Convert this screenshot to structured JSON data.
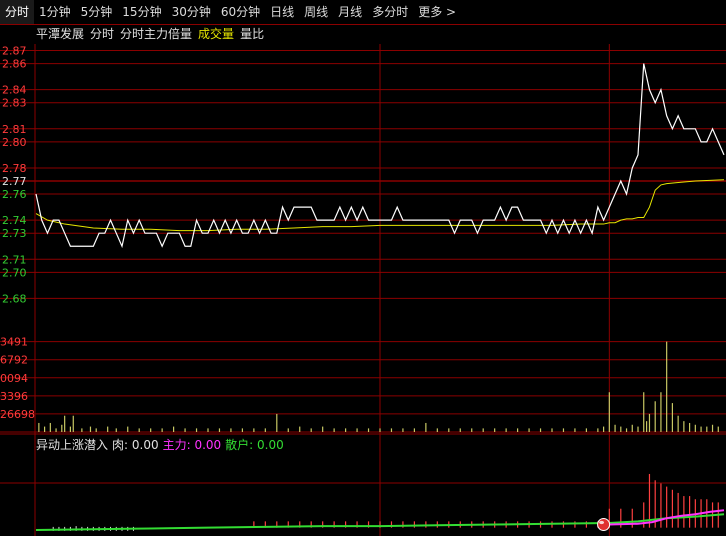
{
  "tabs": [
    "分时",
    "1分钟",
    "5分钟",
    "15分钟",
    "30分钟",
    "60分钟",
    "日线",
    "周线",
    "月线",
    "多分时",
    "更多 >"
  ],
  "active_tab": 0,
  "legend_top": [
    {
      "label": "平潭发展",
      "color": "#e0e0e0"
    },
    {
      "label": "分时",
      "color": "#e0e0e0"
    },
    {
      "label": "分时主力倍量",
      "color": "#e0e0e0"
    },
    {
      "label": "成交量",
      "color": "#e6e600"
    },
    {
      "label": "量比",
      "color": "#e0e0e0"
    }
  ],
  "legend_bottom": [
    {
      "label": "异动上涨潜入",
      "color": "#e0e0e0"
    },
    {
      "label": "肉: 0.00",
      "color": "#e0e0e0"
    },
    {
      "label": "主力: 0.00",
      "color": "#ff33ff"
    },
    {
      "label": "散户: 0.00",
      "color": "#33dd33"
    }
  ],
  "colors": {
    "grid": "#8b0000",
    "up": "#ff3b3b",
    "down": "#33cc33",
    "price": "#ffffff",
    "avg": "#e6e600",
    "vol": "#c8c864",
    "main": "#ff33ff",
    "retail": "#33dd33",
    "bar_red": "#ff4040",
    "bar_white": "#dddddd"
  },
  "chart_data": [
    {
      "type": "line",
      "name": "price",
      "y_ticks": [
        2.87,
        2.86,
        2.84,
        2.83,
        2.81,
        2.8,
        2.78,
        2.77,
        2.76,
        2.74,
        2.73,
        2.71,
        2.7,
        2.68
      ],
      "y_ticks_up": [
        2.87,
        2.86,
        2.84,
        2.83,
        2.81,
        2.8,
        2.78
      ],
      "y_ticks_down": [
        2.76,
        2.74,
        2.73,
        2.71,
        2.7,
        2.68
      ],
      "y_ticks_neutral": [
        2.77
      ],
      "ylim": [
        2.665,
        2.875
      ],
      "xlim": [
        0,
        240
      ],
      "series": [
        {
          "x": [
            0,
            2,
            4,
            6,
            8,
            10,
            12,
            14,
            16,
            18,
            20,
            22,
            24,
            26,
            28,
            30,
            32,
            34,
            36,
            38,
            40,
            42,
            44,
            46,
            48,
            50,
            52,
            54,
            56,
            58,
            60,
            62,
            64,
            66,
            68,
            70,
            72,
            74,
            76,
            78,
            80,
            82,
            84,
            86,
            88,
            90,
            92,
            94,
            96,
            98,
            100,
            102,
            104,
            106,
            108,
            110,
            112,
            114,
            116,
            118,
            120,
            122,
            124,
            126,
            128,
            130,
            132,
            134,
            136,
            138,
            140,
            142,
            144,
            146,
            148,
            150,
            152,
            154,
            156,
            158,
            160,
            162,
            164,
            166,
            168,
            170,
            172,
            174,
            176,
            178,
            180,
            182,
            184,
            186,
            188,
            190,
            192,
            194,
            196,
            198,
            200,
            202,
            204,
            206,
            208,
            210,
            212,
            214,
            216,
            218,
            220,
            222,
            224,
            226,
            228,
            230,
            232,
            234,
            236,
            238,
            240
          ],
          "values": [
            2.76,
            2.74,
            2.73,
            2.74,
            2.74,
            2.73,
            2.72,
            2.72,
            2.72,
            2.72,
            2.72,
            2.73,
            2.73,
            2.74,
            2.73,
            2.72,
            2.74,
            2.73,
            2.74,
            2.73,
            2.73,
            2.73,
            2.72,
            2.73,
            2.73,
            2.73,
            2.72,
            2.72,
            2.74,
            2.73,
            2.73,
            2.74,
            2.73,
            2.74,
            2.73,
            2.74,
            2.73,
            2.73,
            2.74,
            2.73,
            2.74,
            2.73,
            2.73,
            2.75,
            2.74,
            2.75,
            2.75,
            2.75,
            2.75,
            2.74,
            2.74,
            2.74,
            2.74,
            2.75,
            2.74,
            2.75,
            2.74,
            2.75,
            2.74,
            2.74,
            2.74,
            2.74,
            2.74,
            2.75,
            2.74,
            2.74,
            2.74,
            2.74,
            2.74,
            2.74,
            2.74,
            2.74,
            2.74,
            2.73,
            2.74,
            2.74,
            2.74,
            2.73,
            2.74,
            2.74,
            2.74,
            2.75,
            2.74,
            2.75,
            2.75,
            2.74,
            2.74,
            2.74,
            2.74,
            2.73,
            2.74,
            2.73,
            2.74,
            2.73,
            2.74,
            2.73,
            2.74,
            2.73,
            2.75,
            2.74,
            2.75,
            2.76,
            2.77,
            2.76,
            2.78,
            2.78,
            2.77,
            2.77,
            2.77,
            2.77,
            2.78,
            2.79,
            2.85,
            2.83,
            2.84,
            2.82,
            2.82,
            2.81,
            2.81,
            2.81,
            2.81
          ]
        },
        {
          "name": "avg",
          "x": [
            0,
            4,
            10,
            20,
            30,
            40,
            50,
            60,
            70,
            80,
            90,
            100,
            110,
            120,
            130,
            140,
            150,
            160,
            170,
            180,
            190,
            198,
            200,
            202,
            204,
            206,
            208,
            210,
            212,
            214,
            216,
            218,
            220,
            225,
            230,
            240
          ],
          "values": [
            2.745,
            2.74,
            2.737,
            2.734,
            2.733,
            2.733,
            2.732,
            2.732,
            2.733,
            2.733,
            2.734,
            2.735,
            2.735,
            2.736,
            2.736,
            2.736,
            2.736,
            2.736,
            2.736,
            2.736,
            2.737,
            2.737,
            2.738,
            2.738,
            2.74,
            2.741,
            2.741,
            2.742,
            2.742,
            2.75,
            2.763,
            2.767,
            2.768,
            2.769,
            2.77,
            2.771
          ]
        }
      ],
      "price_tail": {
        "x": [
          208,
          210,
          212,
          214,
          216,
          218,
          220,
          222,
          224,
          226,
          228,
          230,
          232,
          234,
          236,
          238,
          240
        ],
        "values": [
          2.78,
          2.79,
          2.86,
          2.84,
          2.83,
          2.84,
          2.82,
          2.81,
          2.82,
          2.81,
          2.81,
          2.81,
          2.8,
          2.8,
          2.81,
          2.8,
          2.79
        ]
      }
    },
    {
      "type": "bar",
      "name": "volume",
      "y_ticks": [
        "3491",
        "6792",
        "0094",
        "3396",
        "26698"
      ],
      "y_tick_values": [
        5,
        4,
        3,
        2,
        1
      ],
      "ylim": [
        0,
        5.2
      ],
      "xlim": [
        0,
        240
      ],
      "x": [
        1,
        3,
        5,
        7,
        9,
        10,
        12,
        13,
        16,
        19,
        21,
        25,
        28,
        32,
        36,
        40,
        44,
        48,
        52,
        56,
        60,
        64,
        68,
        72,
        76,
        80,
        84,
        88,
        92,
        96,
        100,
        104,
        108,
        112,
        116,
        120,
        124,
        128,
        132,
        136,
        140,
        144,
        148,
        152,
        156,
        160,
        164,
        168,
        172,
        176,
        180,
        184,
        188,
        192,
        196,
        198,
        200,
        202,
        204,
        206,
        208,
        210,
        212,
        213,
        214,
        216,
        218,
        220,
        222,
        224,
        226,
        228,
        230,
        232,
        234,
        236,
        238
      ],
      "values": [
        0.5,
        0.3,
        0.5,
        0.2,
        0.4,
        0.9,
        0.3,
        0.9,
        0.2,
        0.3,
        0.2,
        0.3,
        0.2,
        0.3,
        0.2,
        0.2,
        0.2,
        0.3,
        0.2,
        0.2,
        0.2,
        0.2,
        0.2,
        0.2,
        0.2,
        0.2,
        1.0,
        0.2,
        0.3,
        0.2,
        0.3,
        0.2,
        0.2,
        0.2,
        0.2,
        0.2,
        0.2,
        0.2,
        0.2,
        0.5,
        0.2,
        0.2,
        0.2,
        0.2,
        0.2,
        0.2,
        0.2,
        0.2,
        0.2,
        0.2,
        0.2,
        0.2,
        0.2,
        0.2,
        0.2,
        0.3,
        2.2,
        0.4,
        0.3,
        0.2,
        0.4,
        0.3,
        2.2,
        0.6,
        1.0,
        1.7,
        2.2,
        5.0,
        1.6,
        0.9,
        0.6,
        0.5,
        0.4,
        0.3,
        0.3,
        0.4,
        0.3
      ]
    },
    {
      "type": "bar",
      "name": "异动上涨潜入",
      "ylim": [
        0,
        1
      ],
      "xlim": [
        0,
        240
      ],
      "white_bars": {
        "x": [
          6,
          8,
          10,
          12,
          14,
          16,
          18,
          20,
          22,
          24,
          26,
          28,
          30,
          32,
          34
        ],
        "values": [
          0.05,
          0.05,
          0.05,
          0.05,
          0.06,
          0.05,
          0.05,
          0.05,
          0.05,
          0.05,
          0.05,
          0.05,
          0.05,
          0.05,
          0.05
        ]
      },
      "red_bars": {
        "x": [
          76,
          80,
          84,
          88,
          92,
          96,
          100,
          104,
          108,
          112,
          116,
          120,
          124,
          128,
          132,
          136,
          140,
          144,
          148,
          152,
          156,
          160,
          164,
          168,
          172,
          176,
          180,
          184,
          188,
          192,
          196,
          200,
          204,
          208,
          212,
          214,
          216,
          218,
          220,
          222,
          224,
          226,
          228,
          230,
          232,
          234,
          236,
          238
        ],
        "values": [
          0.1,
          0.1,
          0.1,
          0.1,
          0.1,
          0.1,
          0.1,
          0.1,
          0.1,
          0.1,
          0.1,
          0.1,
          0.1,
          0.1,
          0.1,
          0.1,
          0.1,
          0.1,
          0.1,
          0.1,
          0.1,
          0.1,
          0.1,
          0.1,
          0.1,
          0.1,
          0.1,
          0.1,
          0.1,
          0.1,
          0.1,
          0.3,
          0.3,
          0.3,
          0.4,
          0.85,
          0.75,
          0.7,
          0.65,
          0.6,
          0.55,
          0.5,
          0.5,
          0.45,
          0.45,
          0.45,
          0.4,
          0.4
        ]
      },
      "retail_line": {
        "x": [
          0,
          20,
          40,
          60,
          80,
          100,
          120,
          140,
          160,
          180,
          200,
          210,
          220,
          230,
          240
        ],
        "values": [
          0.05,
          0.06,
          0.07,
          0.08,
          0.09,
          0.1,
          0.1,
          0.11,
          0.12,
          0.13,
          0.14,
          0.16,
          0.2,
          0.22,
          0.25
        ]
      },
      "main_line": {
        "x": [
          200,
          210,
          215,
          220,
          225,
          230,
          235,
          240
        ],
        "values": [
          0.12,
          0.13,
          0.15,
          0.2,
          0.23,
          0.25,
          0.28,
          0.3
        ]
      },
      "marker_x": 198
    }
  ]
}
